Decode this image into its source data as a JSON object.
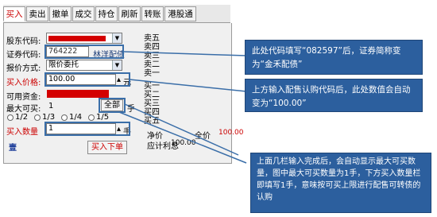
{
  "tabs": [
    "买入",
    "卖出",
    "撤单",
    "成交",
    "持仓",
    "刷新",
    "转账",
    "港股通"
  ],
  "form": {
    "shareholder_code_label": "股东代码:",
    "security_code_label": "证券代码:",
    "security_code_value": "764222",
    "security_name_value": "林洋配债",
    "quote_type_label": "报价方式:",
    "quote_type_value": "限价委托",
    "buy_price_label": "买入价格:",
    "buy_price_value": "100.00",
    "price_unit": "元",
    "available_funds_label": "可用资金:",
    "max_buy_label": "最大可买:",
    "max_buy_value": "1",
    "all_button": "全部",
    "hand_unit_1": "手",
    "fractions": [
      "1/2",
      "1/3",
      "1/4",
      "1/5"
    ],
    "buy_qty_label": "买入数量",
    "buy_qty_value": "1",
    "hand_unit_2": "手",
    "submit_button": "买入下单",
    "side_char": "壹"
  },
  "orderbook": {
    "rows": [
      "卖五",
      "卖四",
      "卖三",
      "卖二",
      "卖一",
      "买一",
      "买二",
      "买三",
      "买四",
      "买五"
    ],
    "net_price_label": "净价",
    "full_price_label": "全价",
    "full_price_value": "100.00",
    "accrued_label": "应计利息",
    "net_value": "100.00"
  },
  "callouts": {
    "c1": "此处代码填写“082597”后，证券简称变为“金禾配债”",
    "c2": "上方输入配售认购代码后，此处数值会自动变为“100.00”",
    "c3": "上面几栏输入完成后，会自动显示最大可买数量，图中最大可买数量为1手，下方买入数量栏即填写1手，意味按可买上限进行配售可转债的认购"
  },
  "colors": {
    "accent_red": "#cc0000",
    "callout_blue": "#2c5f9e",
    "highlight_blue": "#3a6ea8"
  }
}
